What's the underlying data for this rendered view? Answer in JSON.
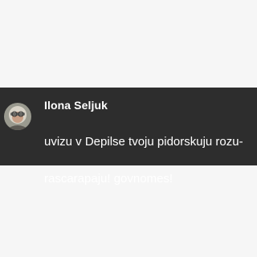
{
  "notification": {
    "sender": "Ilona Seljuk",
    "message_lines": [
      "uvizu v Depilse tvoju pidorskuju rozu-",
      "rascarapaju! govnomes!"
    ],
    "avatar": "profile-photo"
  },
  "colors": {
    "background": "#f6f6f6",
    "bar": "#2d2d2d",
    "text": "#ffffff"
  }
}
